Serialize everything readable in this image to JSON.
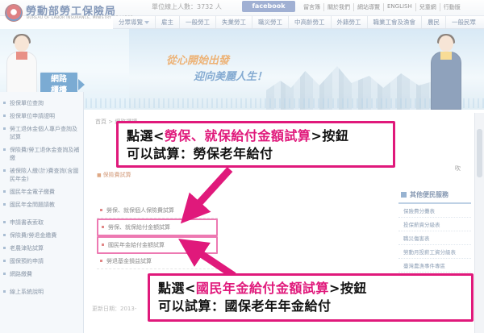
{
  "header": {
    "site_name": "勞動部勞工保險局",
    "site_name_en": "BUREAU OF LABOR INSURANCE, MINISTRY OF LABOR",
    "visitors": "單位線上人數：3732 人",
    "facebook_label": "facebook",
    "top_links": [
      "留言簿",
      "關於我們",
      "網站導覽",
      "ENGLISH",
      "兒童網",
      "行動版"
    ]
  },
  "main_nav": {
    "items": [
      "分眾導覽",
      "雇主",
      "一般勞工",
      "失業勞工",
      "職災勞工",
      "中高齡勞工",
      "外籍勞工",
      "職業工會及漁會",
      "農民",
      "一般民眾"
    ]
  },
  "banner": {
    "web_counter_line1": "網路",
    "web_counter_line2": "櫃檯",
    "slogan_line1": "從心開始出發",
    "slogan_line2": "迎向美麗人生！"
  },
  "sidebar": {
    "items": [
      "投保單位查詢",
      "投保單位申請證明",
      "勞工退休金個人專戶查詢及試算",
      "保險費/勞工退休金查詢及補繳",
      "被保險人繳(計)費查詢(含國民年金)",
      "國民年金電子繳費",
      "國民年金問題請教",
      "申請書表索取",
      "保險費/勞退金繳費",
      "老農津貼試算",
      "國保預約申請",
      "網路繳費",
      "線上系統說明"
    ]
  },
  "content": {
    "breadcrumb": "首頁 > 網路櫃檯",
    "section_title": "保險費試算",
    "links": [
      {
        "label": "勞保、就保個人保險費試算",
        "highlight": false
      },
      {
        "label": "勞保、就保給付金額試算",
        "highlight": true
      },
      {
        "label": "國民年金給付金額試算",
        "highlight": true
      },
      {
        "label": "勞退基金損益試算",
        "highlight": false
      }
    ],
    "update_date": "更新日期：2013-"
  },
  "right_panel": {
    "edge_text": "吹",
    "heading": "其他便民服務",
    "items": [
      "保險費分攤表",
      "投保薪資分級表",
      "職災傷害表",
      "勞動月投薪工資分級表",
      "臺灣農漁事件專區"
    ]
  },
  "callouts": {
    "c1": {
      "line1_prefix": "點選<",
      "line1_link": "勞保、就保給付金額試算",
      "line1_suffix": ">按鈕",
      "line2": "可以試算：勞保老年給付"
    },
    "c2": {
      "line1_prefix": "點選<",
      "line1_link": "國民年金給付金額試算",
      "line1_suffix": ">按鈕",
      "line2": "可以試算：國保老年年金給付"
    }
  },
  "colors": {
    "accent_pink": "#e0197b",
    "nav_blue": "#2b4f87"
  }
}
